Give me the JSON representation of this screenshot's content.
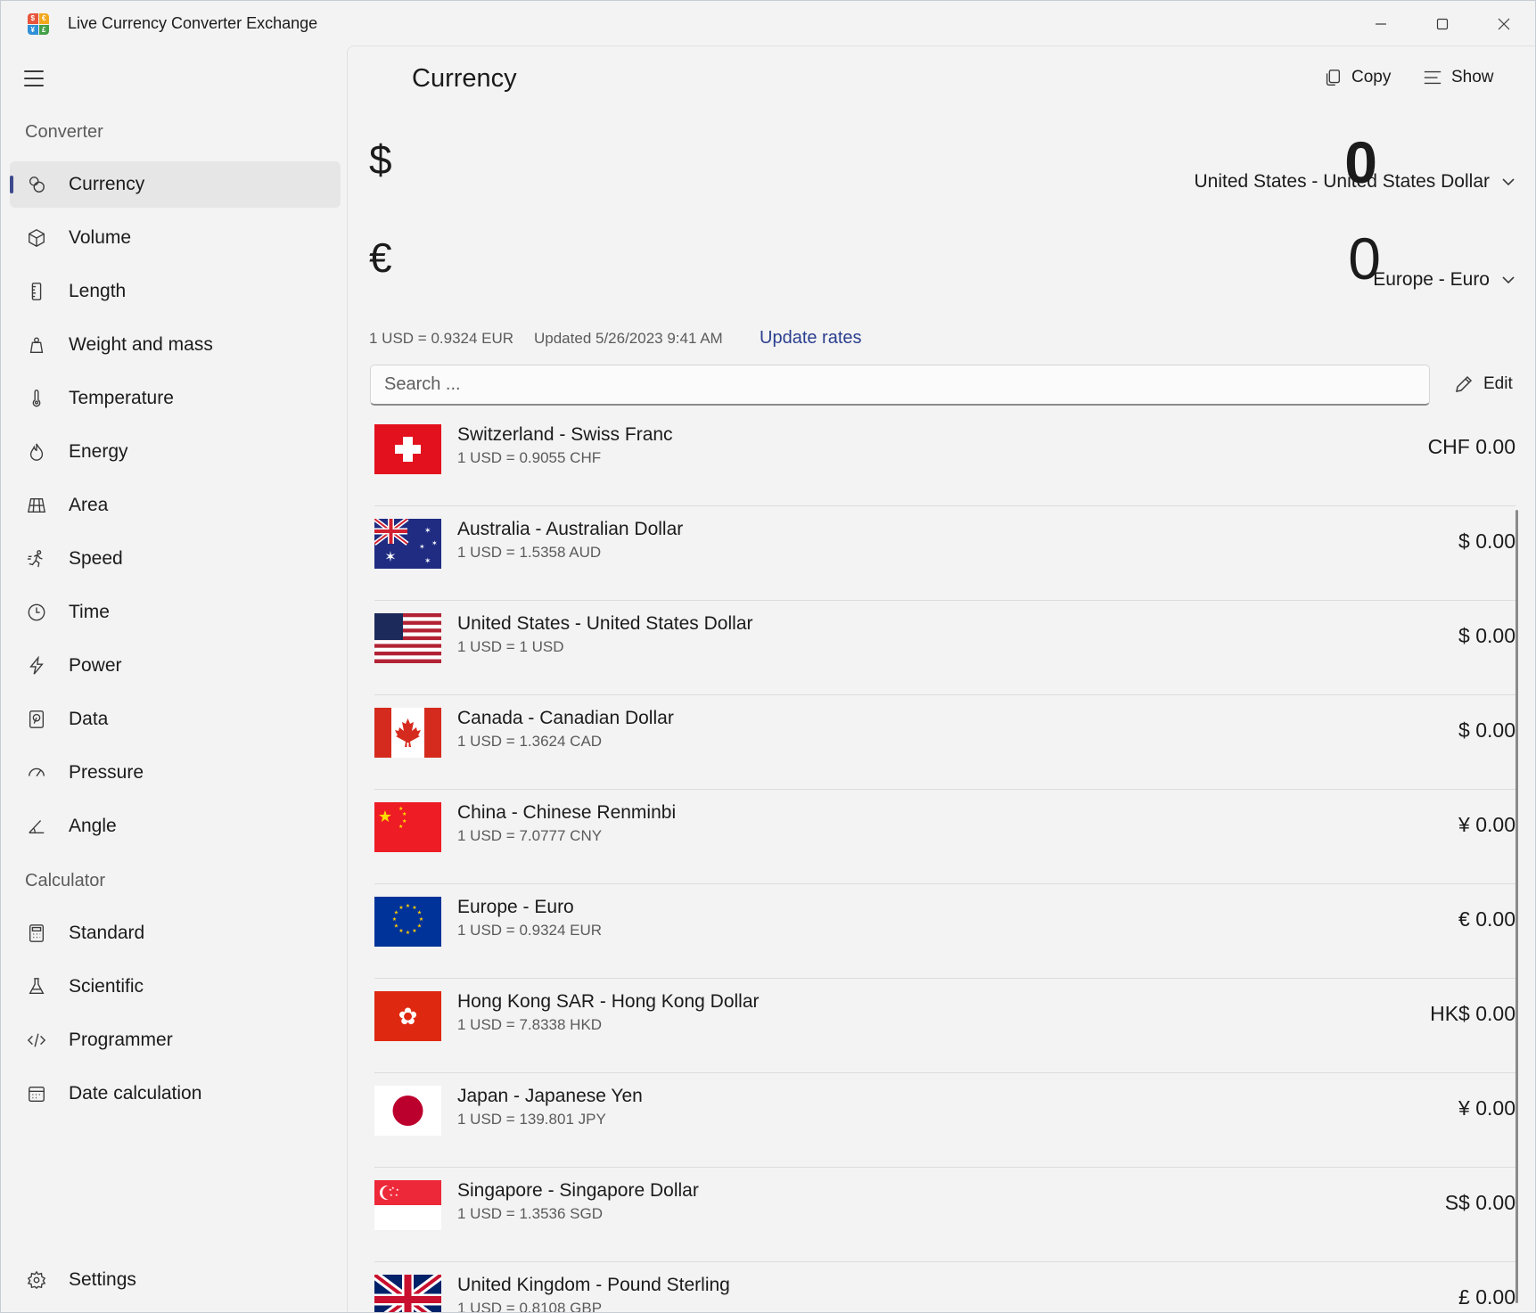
{
  "window": {
    "title": "Live Currency Converter Exchange",
    "app_icon_glyphs": [
      "$",
      "€",
      "¥",
      "£"
    ]
  },
  "sidebar": {
    "converter_heading": "Converter",
    "calculator_heading": "Calculator",
    "converter_items": [
      {
        "label": "Currency",
        "icon": "currency-icon",
        "selected": true
      },
      {
        "label": "Volume",
        "icon": "cube-icon"
      },
      {
        "label": "Length",
        "icon": "ruler-icon"
      },
      {
        "label": "Weight and mass",
        "icon": "weight-icon"
      },
      {
        "label": "Temperature",
        "icon": "thermometer-icon"
      },
      {
        "label": "Energy",
        "icon": "flame-icon"
      },
      {
        "label": "Area",
        "icon": "grid-icon"
      },
      {
        "label": "Speed",
        "icon": "runner-icon"
      },
      {
        "label": "Time",
        "icon": "clock-icon"
      },
      {
        "label": "Power",
        "icon": "lightning-icon"
      },
      {
        "label": "Data",
        "icon": "storage-icon"
      },
      {
        "label": "Pressure",
        "icon": "gauge-icon"
      },
      {
        "label": "Angle",
        "icon": "angle-icon"
      }
    ],
    "calculator_items": [
      {
        "label": "Standard",
        "icon": "calculator-icon"
      },
      {
        "label": "Scientific",
        "icon": "flask-icon"
      },
      {
        "label": "Programmer",
        "icon": "code-icon"
      },
      {
        "label": "Date calculation",
        "icon": "calendar-icon"
      }
    ],
    "settings_label": "Settings"
  },
  "main": {
    "title": "Currency",
    "copy_label": "Copy",
    "show_label": "Show",
    "from": {
      "symbol": "$",
      "amount": "0",
      "currency": "United States - United States Dollar"
    },
    "to": {
      "symbol": "€",
      "amount": "0",
      "currency": "Europe - Euro"
    },
    "rate_text": "1 USD = 0.9324 EUR",
    "updated_text": "Updated 5/26/2023 9:41 AM",
    "update_link": "Update rates",
    "search_placeholder": "Search ...",
    "edit_label": "Edit",
    "currencies": [
      {
        "name": "Switzerland - Swiss Franc",
        "rate": "1 USD = 0.9055 CHF",
        "value": "CHF 0.00",
        "flag": "ch"
      },
      {
        "name": "Australia - Australian Dollar",
        "rate": "1 USD = 1.5358 AUD",
        "value": "$ 0.00",
        "flag": "au"
      },
      {
        "name": "United States - United States Dollar",
        "rate": "1 USD = 1 USD",
        "value": "$ 0.00",
        "flag": "us"
      },
      {
        "name": "Canada - Canadian Dollar",
        "rate": "1 USD = 1.3624 CAD",
        "value": "$ 0.00",
        "flag": "ca"
      },
      {
        "name": "China - Chinese Renminbi",
        "rate": "1 USD = 7.0777 CNY",
        "value": "¥ 0.00",
        "flag": "cn"
      },
      {
        "name": "Europe - Euro",
        "rate": "1 USD = 0.9324 EUR",
        "value": "€ 0.00",
        "flag": "eu"
      },
      {
        "name": "Hong Kong SAR - Hong Kong Dollar",
        "rate": "1 USD = 7.8338 HKD",
        "value": "HK$ 0.00",
        "flag": "hk"
      },
      {
        "name": "Japan - Japanese Yen",
        "rate": "1 USD = 139.801 JPY",
        "value": "¥ 0.00",
        "flag": "jp"
      },
      {
        "name": "Singapore - Singapore Dollar",
        "rate": "1 USD = 1.3536 SGD",
        "value": "S$ 0.00",
        "flag": "sg"
      },
      {
        "name": "United Kingdom - Pound Sterling",
        "rate": "1 USD = 0.8108 GBP",
        "value": "£ 0.00",
        "flag": "gb"
      }
    ]
  },
  "colors": {
    "accent": "#3c4a8c",
    "link": "#2b3f8f",
    "background": "#f3f3f3"
  }
}
